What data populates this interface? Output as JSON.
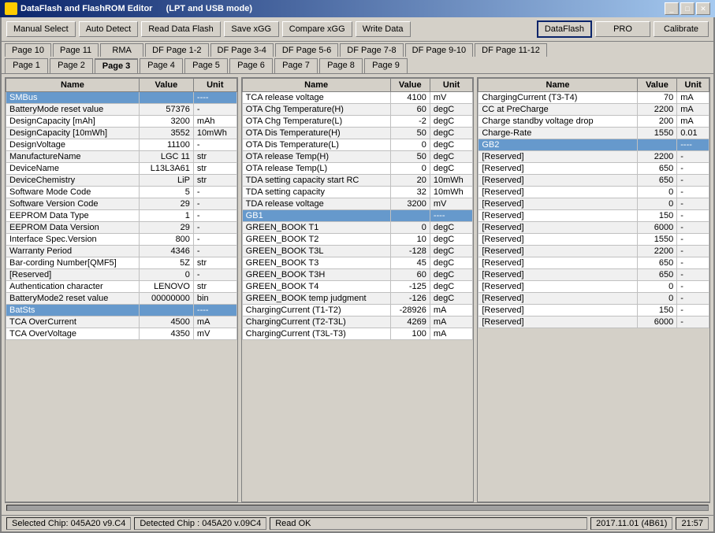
{
  "titleBar": {
    "title": "DataFlash  and  FlashROM  Editor",
    "subtitle": "(LPT and USB mode)",
    "buttons": [
      "_",
      "□",
      "✕"
    ]
  },
  "toolbar": {
    "buttons": [
      {
        "label": "Manual Select",
        "active": false
      },
      {
        "label": "Auto Detect",
        "active": false
      },
      {
        "label": "Read Data Flash",
        "active": false
      },
      {
        "label": "Save xGG",
        "active": false
      },
      {
        "label": "Compare xGG",
        "active": false
      },
      {
        "label": "Write Data",
        "active": false
      },
      {
        "label": "DataFlash",
        "active": true
      },
      {
        "label": "PRO",
        "active": false
      },
      {
        "label": "Calibrate",
        "active": false
      }
    ]
  },
  "tabRow1": [
    {
      "label": "Page 10"
    },
    {
      "label": "Page 11"
    },
    {
      "label": "RMA"
    },
    {
      "label": "DF Page 1-2"
    },
    {
      "label": "DF Page 3-4"
    },
    {
      "label": "DF Page 5-6"
    },
    {
      "label": "DF Page 7-8"
    },
    {
      "label": "DF Page 9-10"
    },
    {
      "label": "DF Page 11-12"
    }
  ],
  "tabRow2": [
    {
      "label": "Page 1"
    },
    {
      "label": "Page 2"
    },
    {
      "label": "Page 3",
      "active": true
    },
    {
      "label": "Page 4"
    },
    {
      "label": "Page 5"
    },
    {
      "label": "Page 6"
    },
    {
      "label": "Page 7"
    },
    {
      "label": "Page 8"
    },
    {
      "label": "Page 9"
    }
  ],
  "panel1": {
    "headers": [
      "Name",
      "Value",
      "Unit"
    ],
    "rows": [
      {
        "name": "SMBus",
        "value": "",
        "unit": "----",
        "highlight": "blue"
      },
      {
        "name": "BatteryMode reset value",
        "value": "57376",
        "unit": "-"
      },
      {
        "name": "DesignCapacity [mAh]",
        "value": "3200",
        "unit": "mAh"
      },
      {
        "name": "DesignCapacity [10mWh]",
        "value": "3552",
        "unit": "10mWh"
      },
      {
        "name": "DesignVoltage",
        "value": "11100",
        "unit": "-"
      },
      {
        "name": "ManufactureName",
        "value": "LGC 11",
        "unit": "str"
      },
      {
        "name": "DeviceName",
        "value": "L13L3A61",
        "unit": "str"
      },
      {
        "name": "DeviceChemistry",
        "value": "LiP",
        "unit": "str"
      },
      {
        "name": "Software Mode Code",
        "value": "5",
        "unit": "-"
      },
      {
        "name": "Software Version Code",
        "value": "29",
        "unit": "-"
      },
      {
        "name": "EEPROM Data Type",
        "value": "1",
        "unit": "-"
      },
      {
        "name": "EEPROM Data Version",
        "value": "29",
        "unit": "-"
      },
      {
        "name": "Interface Spec.Version",
        "value": "800",
        "unit": "-"
      },
      {
        "name": "Warranty Period",
        "value": "4346",
        "unit": "-"
      },
      {
        "name": "Bar-cording Number[QMF5]",
        "value": "5Z",
        "unit": "str"
      },
      {
        "name": "[Reserved]",
        "value": "0",
        "unit": "-"
      },
      {
        "name": "Authentication character",
        "value": "LENOVO",
        "unit": "str"
      },
      {
        "name": "BatteryMode2 reset value",
        "value": "00000000",
        "unit": "bin"
      },
      {
        "name": "BatSts",
        "value": "",
        "unit": "----",
        "highlight": "blue"
      },
      {
        "name": "TCA OverCurrent",
        "value": "4500",
        "unit": "mA"
      },
      {
        "name": "TCA OverVoltage",
        "value": "4350",
        "unit": "mV"
      }
    ]
  },
  "panel2": {
    "headers": [
      "Name",
      "Value",
      "Unit"
    ],
    "rows": [
      {
        "name": "TCA release voltage",
        "value": "4100",
        "unit": "mV"
      },
      {
        "name": "OTA Chg Temperature(H)",
        "value": "60",
        "unit": "degC"
      },
      {
        "name": "OTA Chg Temperature(L)",
        "value": "-2",
        "unit": "degC"
      },
      {
        "name": "OTA Dis Temperature(H)",
        "value": "50",
        "unit": "degC"
      },
      {
        "name": "OTA Dis Temperature(L)",
        "value": "0",
        "unit": "degC"
      },
      {
        "name": "OTA release Temp(H)",
        "value": "50",
        "unit": "degC"
      },
      {
        "name": "OTA release Temp(L)",
        "value": "0",
        "unit": "degC"
      },
      {
        "name": "TDA setting capacity start RC",
        "value": "20",
        "unit": "10mWh"
      },
      {
        "name": "TDA setting capacity",
        "value": "32",
        "unit": "10mWh"
      },
      {
        "name": "TDA release voltage",
        "value": "3200",
        "unit": "mV"
      },
      {
        "name": "GB1",
        "value": "",
        "unit": "----",
        "highlight": "blue"
      },
      {
        "name": "GREEN_BOOK T1",
        "value": "0",
        "unit": "degC"
      },
      {
        "name": "GREEN_BOOK T2",
        "value": "10",
        "unit": "degC"
      },
      {
        "name": "GREEN_BOOK T3L",
        "value": "-128",
        "unit": "degC"
      },
      {
        "name": "GREEN_BOOK T3",
        "value": "45",
        "unit": "degC"
      },
      {
        "name": "GREEN_BOOK T3H",
        "value": "60",
        "unit": "degC"
      },
      {
        "name": "GREEN_BOOK T4",
        "value": "-125",
        "unit": "degC"
      },
      {
        "name": "GREEN_BOOK temp judgment",
        "value": "-126",
        "unit": "degC"
      },
      {
        "name": "ChargingCurrent (T1-T2)",
        "value": "-28926",
        "unit": "mA"
      },
      {
        "name": "ChargingCurrent (T2-T3L)",
        "value": "4269",
        "unit": "mA"
      },
      {
        "name": "ChargingCurrent (T3L-T3)",
        "value": "100",
        "unit": "mA"
      }
    ]
  },
  "panel3": {
    "headers": [
      "Name",
      "Value",
      "Unit"
    ],
    "rows": [
      {
        "name": "ChargingCurrent (T3-T4)",
        "value": "70",
        "unit": "mA"
      },
      {
        "name": "CC at PreCharge",
        "value": "2200",
        "unit": "mA"
      },
      {
        "name": "Charge standby voltage drop",
        "value": "200",
        "unit": "mA"
      },
      {
        "name": "Charge-Rate",
        "value": "1550",
        "unit": "0.01"
      },
      {
        "name": "GB2",
        "value": "",
        "unit": "----",
        "highlight": "blue"
      },
      {
        "name": "[Reserved]",
        "value": "2200",
        "unit": "-"
      },
      {
        "name": "[Reserved]",
        "value": "650",
        "unit": "-"
      },
      {
        "name": "[Reserved]",
        "value": "650",
        "unit": "-"
      },
      {
        "name": "[Reserved]",
        "value": "0",
        "unit": "-"
      },
      {
        "name": "[Reserved]",
        "value": "0",
        "unit": "-"
      },
      {
        "name": "[Reserved]",
        "value": "150",
        "unit": "-"
      },
      {
        "name": "[Reserved]",
        "value": "6000",
        "unit": "-"
      },
      {
        "name": "[Reserved]",
        "value": "1550",
        "unit": "-"
      },
      {
        "name": "[Reserved]",
        "value": "2200",
        "unit": "-"
      },
      {
        "name": "[Reserved]",
        "value": "650",
        "unit": "-"
      },
      {
        "name": "[Reserved]",
        "value": "650",
        "unit": "-"
      },
      {
        "name": "[Reserved]",
        "value": "0",
        "unit": "-"
      },
      {
        "name": "[Reserved]",
        "value": "0",
        "unit": "-"
      },
      {
        "name": "[Reserved]",
        "value": "150",
        "unit": "-"
      },
      {
        "name": "[Reserved]",
        "value": "6000",
        "unit": "-"
      }
    ]
  },
  "statusBar": {
    "chip": "Selected Chip: 045A20 v9.C4",
    "detected": "Detected Chip : 045A20  v.09C4",
    "status": "Read OK",
    "date": "2017.11.01 (4B61)",
    "time": "21:57"
  }
}
